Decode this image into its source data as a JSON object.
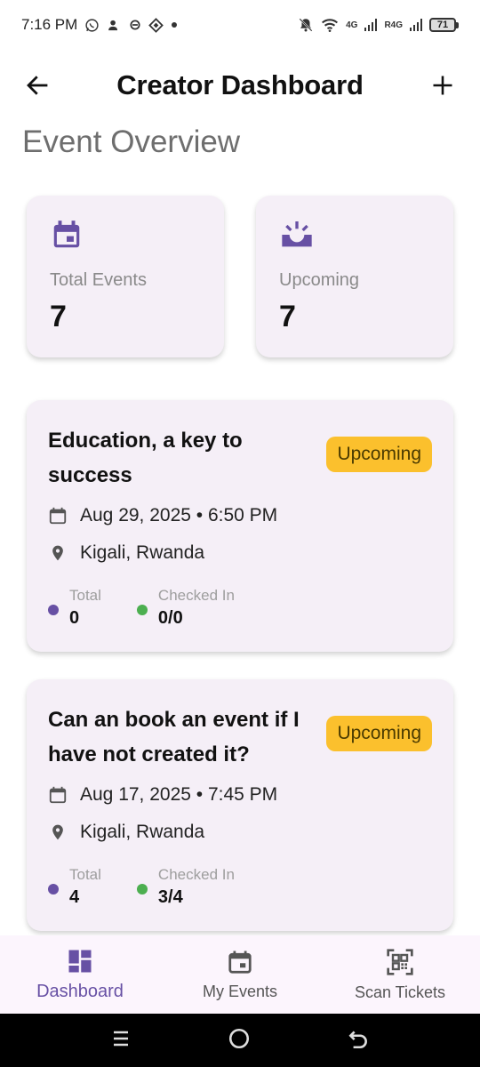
{
  "status_bar": {
    "time": "7:16 PM",
    "net_4g": "4G",
    "net_r4g": "R4G",
    "battery": "71"
  },
  "app_bar": {
    "title": "Creator Dashboard"
  },
  "section_title": "Event Overview",
  "stats": [
    {
      "label": "Total Events",
      "value": "7",
      "icon": "calendar-icon"
    },
    {
      "label": "Upcoming",
      "value": "7",
      "icon": "upcoming-icon"
    }
  ],
  "events": [
    {
      "title": "Education, a key to success",
      "badge": "Upcoming",
      "datetime": "Aug 29, 2025 • 6:50 PM",
      "location": "Kigali, Rwanda",
      "total_label": "Total",
      "total_value": "0",
      "checked_label": "Checked In",
      "checked_value": "0/0"
    },
    {
      "title": "Can an book an event if I have not created it?",
      "badge": "Upcoming",
      "datetime": "Aug 17, 2025 • 7:45 PM",
      "location": "Kigali, Rwanda",
      "total_label": "Total",
      "total_value": "4",
      "checked_label": "Checked In",
      "checked_value": "3/4"
    }
  ],
  "bottom_nav": [
    {
      "label": "Dashboard",
      "icon": "dashboard-icon",
      "active": true
    },
    {
      "label": "My Events",
      "icon": "event-icon",
      "active": false
    },
    {
      "label": "Scan Tickets",
      "icon": "qr-scan-icon",
      "active": false
    }
  ],
  "colors": {
    "accent": "#6750a4",
    "badge": "#fbc02d",
    "card_bg": "#f5eff7",
    "green": "#4caf50"
  }
}
